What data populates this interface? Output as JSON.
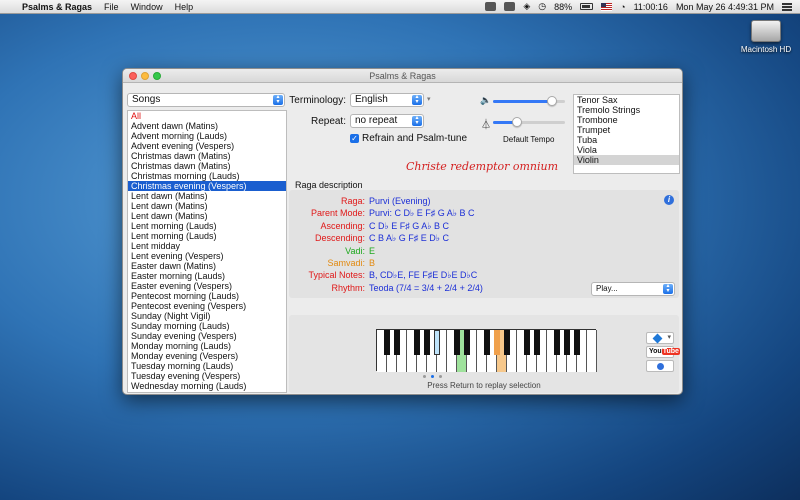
{
  "menubar": {
    "app": "Psalms & Ragas",
    "menus": [
      "File",
      "Window",
      "Help"
    ],
    "battery": "88%",
    "elapsed": "11:00:16",
    "clock": "Mon May 26  4:49:31 PM"
  },
  "desktop": {
    "drive_label": "Macintosh HD"
  },
  "window": {
    "title": "Psalms & Ragas",
    "songs_popup": "Songs",
    "songs": [
      "All",
      "Advent dawn (Matins)",
      "Advent morning (Lauds)",
      "Advent evening (Vespers)",
      "Christmas dawn (Matins)",
      "Christmas dawn (Matins)",
      "Christmas morning (Lauds)",
      "Christmas evening (Vespers)",
      "Lent dawn (Matins)",
      "Lent dawn (Matins)",
      "Lent dawn (Matins)",
      "Lent morning (Lauds)",
      "Lent morning (Lauds)",
      "Lent midday",
      "Lent evening (Vespers)",
      "Easter dawn (Matins)",
      "Easter morning (Lauds)",
      "Easter evening (Vespers)",
      "Pentecost morning (Lauds)",
      "Pentecost evening (Vespers)",
      "Sunday (Night Vigil)",
      "Sunday morning (Lauds)",
      "Sunday evening (Vespers)",
      "Monday morning (Lauds)",
      "Monday evening (Vespers)",
      "Tuesday morning (Lauds)",
      "Tuesday evening (Vespers)",
      "Wednesday morning (Lauds)"
    ],
    "selected_song_index": 7,
    "terminology_label": "Terminology:",
    "terminology_value": "English",
    "repeat_label": "Repeat:",
    "repeat_value": "no repeat",
    "refrain_label": "Refrain and Psalm-tune",
    "refrain_checked": true,
    "volume_level": 0.82,
    "tempo_level": 0.34,
    "default_tempo_label": "Default Tempo",
    "instruments": [
      "Tenor Sax",
      "Tremolo Strings",
      "Trombone",
      "Trumpet",
      "Tuba",
      "Viola",
      "Violin"
    ],
    "selected_instrument_index": 6,
    "song_title": "Christe redemptor omnium",
    "raga_heading": "Raga description",
    "raga": [
      {
        "key": "Raga:",
        "value": "Purvi (Evening)",
        "key_color": "red"
      },
      {
        "key": "Parent Mode:",
        "value": "Purvi: C D♭ E F♯ G A♭ B C",
        "key_color": "red"
      },
      {
        "key": "Ascending:",
        "value": "C D♭ E F♯ G A♭ B C",
        "key_color": "red"
      },
      {
        "key": "Descending:",
        "value": "C B A♭ G F♯ E D♭ C",
        "key_color": "red"
      },
      {
        "key": "Vadi:",
        "value": "E",
        "key_color": "green"
      },
      {
        "key": "Samvadi:",
        "value": "B",
        "key_color": "orange"
      },
      {
        "key": "Typical Notes:",
        "value": "B, CD♭E, FE F♯E D♭E D♭C",
        "key_color": "red"
      },
      {
        "key": "Rhythm:",
        "value": "Teoda (7/4 = 3/4 + 2/4 + 2/4)",
        "key_color": "red"
      }
    ],
    "play_popup": "Play...",
    "replay_hint": "Press Return to replay selection",
    "youtube_you": "You",
    "youtube_tube": "Tube"
  }
}
